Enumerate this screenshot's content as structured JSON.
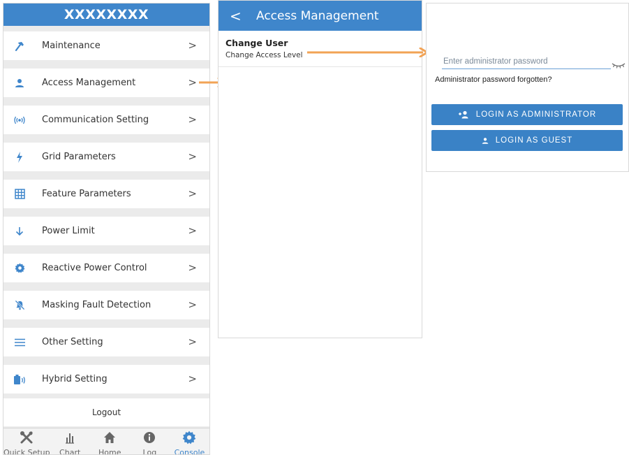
{
  "sidebar": {
    "title": "XXXXXXXX",
    "items": [
      {
        "label": "Maintenance",
        "icon": "hammer-icon"
      },
      {
        "label": "Access Management",
        "icon": "user-icon"
      },
      {
        "label": "Communication Setting",
        "icon": "signal-icon"
      },
      {
        "label": "Grid Parameters",
        "icon": "lightning-icon"
      },
      {
        "label": "Feature Parameters",
        "icon": "grid-icon"
      },
      {
        "label": "Power Limit",
        "icon": "arrow-down-icon"
      },
      {
        "label": "Reactive Power Control",
        "icon": "gear-icon"
      },
      {
        "label": "Masking Fault Detection",
        "icon": "bell-off-icon"
      },
      {
        "label": "Other Setting",
        "icon": "menu-lines-icon"
      },
      {
        "label": "Hybrid Setting",
        "icon": "battery-icon"
      }
    ],
    "chevron": ">",
    "logout": "Logout"
  },
  "bottom_nav": [
    {
      "label": "Quick Setup",
      "icon": "tools-icon"
    },
    {
      "label": "Chart",
      "icon": "bar-chart-icon"
    },
    {
      "label": "Home",
      "icon": "home-icon"
    },
    {
      "label": "Log",
      "icon": "info-icon"
    },
    {
      "label": "Console",
      "icon": "gear-icon",
      "active": true
    }
  ],
  "access": {
    "back": "<",
    "title": "Access Management",
    "row_title": "Change User",
    "row_subtitle": "Change Access Level"
  },
  "login": {
    "password_placeholder": "Enter administrator password",
    "forgot": "Administrator password forgotten?",
    "admin_button": "LOGIN AS ADMINISTRATOR",
    "guest_button": "LOGIN AS GUEST"
  },
  "colors": {
    "accent": "#3f86cb",
    "arrow": "#f2a355"
  }
}
